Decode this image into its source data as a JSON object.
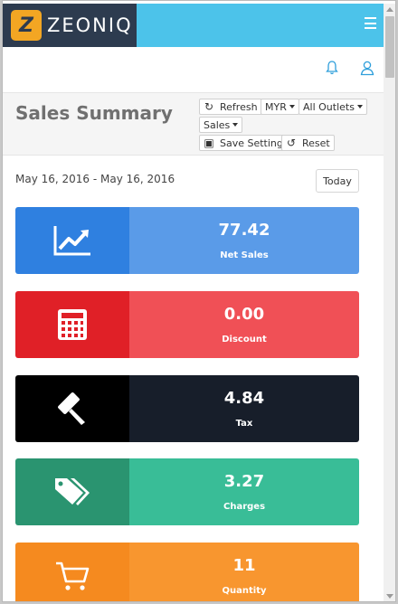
{
  "header": {
    "logo_letter": "Z",
    "brand": "ZEONIQ"
  },
  "toolbar": {
    "title": "Sales Summary",
    "refresh": "Refresh",
    "currency": "MYR",
    "outlets": "All Outlets",
    "metric": "Sales",
    "save_settings": "Save Settings",
    "reset": "Reset"
  },
  "filter": {
    "date_range": "May 16, 2016 - May 16, 2016",
    "today": "Today"
  },
  "stats": [
    {
      "value": "77.42",
      "label": "Net Sales",
      "icon": "trend-chart-icon",
      "icon_bg": "#2f80e0",
      "bg": "#5a9be8"
    },
    {
      "value": "0.00",
      "label": "Discount",
      "icon": "calculator-icon",
      "icon_bg": "#e02027",
      "bg": "#f05056"
    },
    {
      "value": "4.84",
      "label": "Tax",
      "icon": "gavel-icon",
      "icon_bg": "#000000",
      "bg": "#171e2a"
    },
    {
      "value": "3.27",
      "label": "Charges",
      "icon": "tags-icon",
      "icon_bg": "#2a9470",
      "bg": "#39bd97"
    },
    {
      "value": "11",
      "label": "Quantity",
      "icon": "cart-icon",
      "icon_bg": "#f58a1f",
      "bg": "#f8962f"
    }
  ]
}
